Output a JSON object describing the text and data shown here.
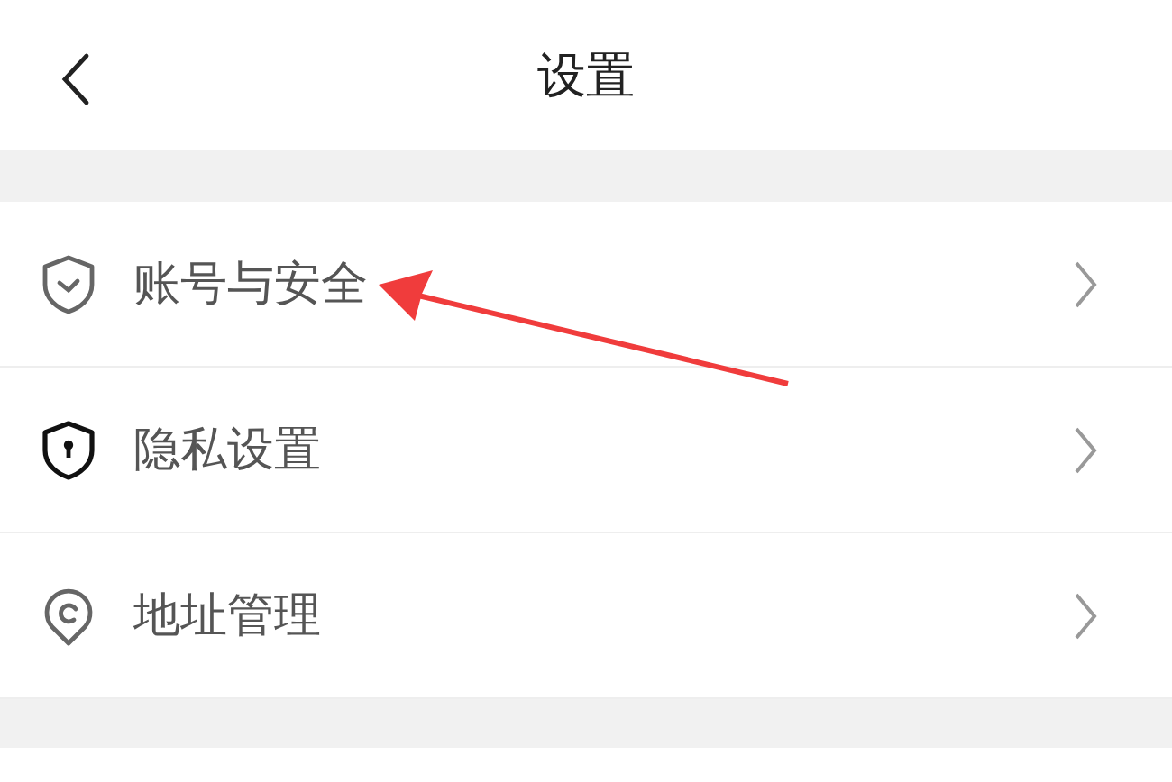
{
  "header": {
    "title": "设置"
  },
  "items": [
    {
      "kind": "shield-check",
      "label": "账号与安全"
    },
    {
      "kind": "shield-lock",
      "label": "隐私设置"
    },
    {
      "kind": "location",
      "label": "地址管理"
    }
  ],
  "annotation": {
    "kind": "arrow",
    "color": "#f03c3c"
  }
}
